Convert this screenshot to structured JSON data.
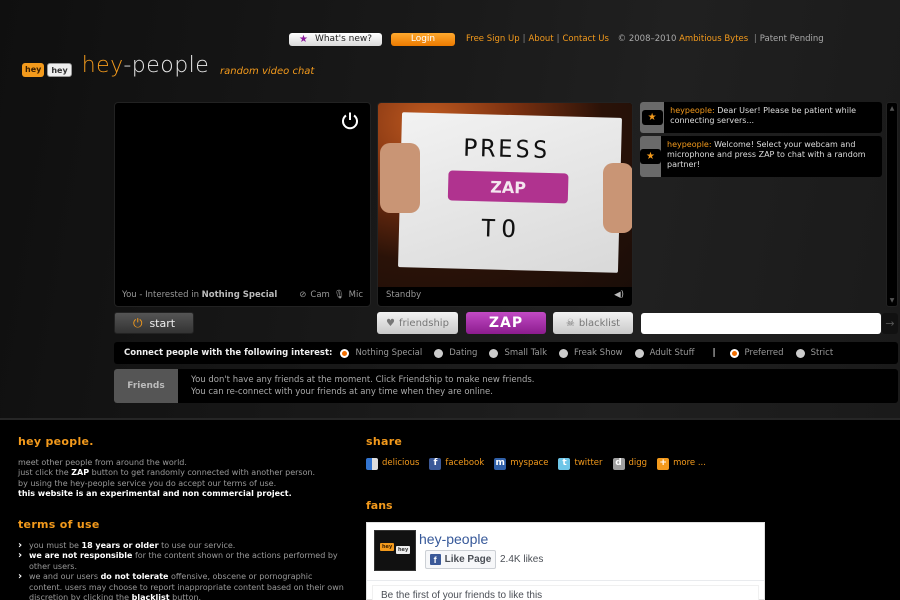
{
  "topbar": {
    "whats_new_label": "What's new?",
    "login_label": "Login",
    "links": [
      "Free Sign Up",
      "About",
      "Contact Us"
    ],
    "copyright_prefix": "© 2008–2010",
    "company": "Ambitious Bytes",
    "patent": "Patent Pending"
  },
  "logo": {
    "bubble1": "hey",
    "bubble2": "hey",
    "name_part1": "hey",
    "name_part2": "-people",
    "tagline": "random video chat"
  },
  "my_video": {
    "caption_prefix": "You - Interested in",
    "caption_interest": "Nothing Special",
    "cam_label": "Cam",
    "mic_label": "Mic"
  },
  "partner_video": {
    "status": "Standby",
    "sign_line1": "PRESS",
    "sign_zap": "ZAP",
    "sign_line2": "TO"
  },
  "chat": {
    "messages": [
      {
        "sender": "heypeople:",
        "text": "Dear User! Please be patient while connecting servers..."
      },
      {
        "sender": "heypeople:",
        "text": "Welcome! Select your webcam and microphone and press ZAP to chat with a random partner!"
      }
    ],
    "input_value": "",
    "send_icon": "→"
  },
  "controls": {
    "start_label": "start",
    "friendship_label": "friendship",
    "zap_label": "ZAP",
    "blacklist_label": "blacklist"
  },
  "interest": {
    "label": "Connect people with the following interest:",
    "options": [
      {
        "label": "Nothing Special",
        "selected": true
      },
      {
        "label": "Dating",
        "selected": false
      },
      {
        "label": "Small Talk",
        "selected": false
      },
      {
        "label": "Freak Show",
        "selected": false
      },
      {
        "label": "Adult Stuff",
        "selected": false
      }
    ],
    "separator": "|",
    "modes": [
      {
        "label": "Preferred",
        "selected": true
      },
      {
        "label": "Strict",
        "selected": false
      }
    ]
  },
  "friends": {
    "tab_label": "Friends",
    "line1": "You don't have any friends at the moment. Click Friendship to make new friends.",
    "line2": "You can re-connect with your friends at any time when they are online."
  },
  "footer": {
    "about": {
      "title": "hey people.",
      "line1": "meet other people from around the world.",
      "line2_pre": "just click the",
      "line2_bold": "ZAP",
      "line2_post": "button to get randomly connected with another person.",
      "line3": "by using the hey-people service you do accept our terms of use.",
      "line4": "this website is an experimental and non commercial project."
    },
    "terms": {
      "title": "terms of use",
      "items": [
        {
          "pre": "you must be",
          "bold": "18 years or older",
          "post": "to use our service."
        },
        {
          "pre": "",
          "bold": "we are not responsible",
          "post": "for the content shown or the actions performed by other users."
        },
        {
          "pre": "we and our users",
          "bold": "do not tolerate",
          "post": "offensive, obscene or pornographic content. users may choose to report inappropriate content based on their own discretion by clicking the",
          "bold2": "blacklist",
          "post2": "button."
        }
      ]
    },
    "share": {
      "title": "share",
      "items": [
        {
          "label": "delicious",
          "icon": "delicious-icon",
          "color": "#3274d0"
        },
        {
          "label": "facebook",
          "icon": "facebook-icon",
          "color": "#3b5998"
        },
        {
          "label": "myspace",
          "icon": "myspace-icon",
          "color": "#3060a8"
        },
        {
          "label": "twitter",
          "icon": "twitter-icon",
          "color": "#6ec6e8"
        },
        {
          "label": "digg",
          "icon": "digg-icon",
          "color": "#a0a0a0"
        },
        {
          "label": "more ...",
          "icon": "plus-icon",
          "color": "#f39a1c"
        }
      ]
    },
    "fans": {
      "title": "fans",
      "page_name": "hey-people",
      "like_label": "Like Page",
      "likes": "2.4K likes",
      "friends_text": "Be the first of your friends to like this"
    }
  },
  "colors": {
    "accent": "#f39a1c",
    "zap": "#a02aa3",
    "background": "#000000"
  }
}
